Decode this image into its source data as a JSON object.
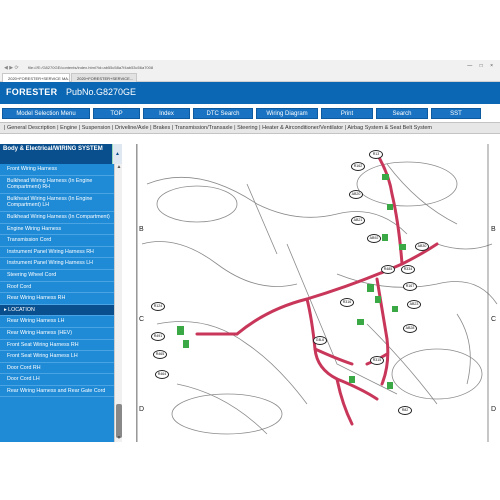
{
  "browser": {
    "url": "file:///E:/G8270GE/contents/index.html?id=ab55c58a7f4ab53c56a7008",
    "tabs": [
      "2020+FORESTER+SERVICE MA...",
      "2020+FORESTER+SERVICE..."
    ],
    "win_controls": "— □ ×"
  },
  "header": {
    "brand": "FORESTER",
    "pub": "PubNo.G8270GE"
  },
  "menu": {
    "items": [
      "Model Selection Menu",
      "TOP",
      "Index",
      "DTC Search",
      "Wiring Diagram",
      "Print",
      "Search",
      "SST"
    ]
  },
  "subnav": {
    "items": [
      "General Description",
      "Engine",
      "Suspension",
      "Driveline/Axle",
      "Brakes",
      "Transmission/Transaxle",
      "Steering",
      "Heater & Airconditioner/Ventilator",
      "Airbag System & Seat Belt System"
    ]
  },
  "sidebar": {
    "title": "Body & Electrical/WIRING SYSTEM",
    "items": [
      "Front Wiring Harness",
      "Bulkhead Wiring Harness (In Engine Compartment) RH",
      "Bulkhead Wiring Harness (In Engine Compartment) LH",
      "Bulkhead Wiring Harness (In Compartment)",
      "Engine Wiring Harness",
      "Transmission Cord",
      "Instrument Panel Wiring Harness RH",
      "Instrument Panel Wiring Harness LH",
      "Steering Wheel Cord",
      "Roof Cord",
      "Rear Wiring Harness RH",
      "LOCATION",
      "Rear Wiring Harness LH",
      "Rear Wiring Harness (HEV)",
      "Front Seat Wiring Harness RH",
      "Front Seat Wiring Harness LH",
      "Door Cord RH",
      "Door Cord LH",
      "Rear Wiring Harness and Rear Gate Cord"
    ]
  },
  "diagram": {
    "grid_letters": [
      "B",
      "C",
      "D"
    ],
    "callouts": [
      "R13",
      "R162",
      "AB20",
      "AB21",
      "AB92",
      "AB30",
      "R485",
      "R334",
      "R167",
      "R124",
      "R491",
      "AB23",
      "AB28",
      "R316",
      "GB-6",
      "R465",
      "R315",
      "R464",
      "R82"
    ],
    "colors": {
      "harness": "#c8365a",
      "connector": "#3aa845"
    }
  }
}
